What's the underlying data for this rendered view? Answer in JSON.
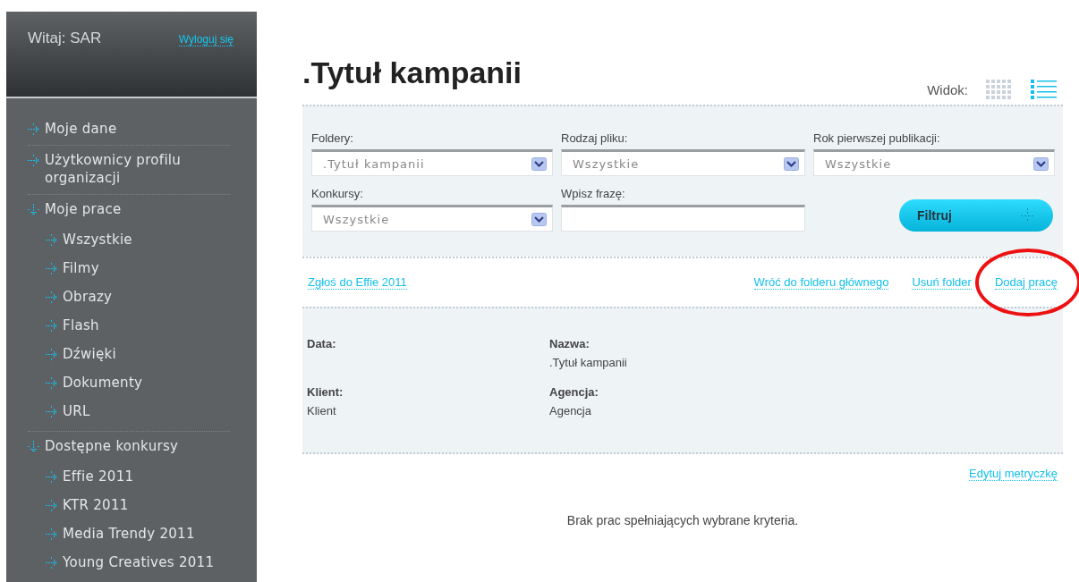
{
  "sidebar": {
    "greeting": "Witaj: SAR",
    "logout": "Wyloguj się",
    "items": [
      {
        "label": "Moje dane",
        "expanded": false
      },
      {
        "label": "Użytkownicy profilu organizacji",
        "expanded": false
      },
      {
        "label": "Moje prace",
        "expanded": true,
        "children": [
          {
            "label": "Wszystkie"
          },
          {
            "label": "Filmy"
          },
          {
            "label": "Obrazy"
          },
          {
            "label": "Flash"
          },
          {
            "label": "Dźwięki"
          },
          {
            "label": "Dokumenty"
          },
          {
            "label": "URL"
          }
        ]
      },
      {
        "label": "Dostępne konkursy",
        "expanded": true,
        "children": [
          {
            "label": "Effie 2011"
          },
          {
            "label": "KTR 2011"
          },
          {
            "label": "Media Trendy 2011"
          },
          {
            "label": "Young Creatives 2011"
          }
        ]
      }
    ]
  },
  "title": ".Tytuł kampanii",
  "view": {
    "label": "Widok:",
    "options": [
      {
        "kind": "grid",
        "selected": false
      },
      {
        "kind": "list",
        "selected": true
      }
    ]
  },
  "filters": [
    {
      "kind": "select",
      "label": "Foldery:",
      "value": ".Tytuł kampanii"
    },
    {
      "kind": "select",
      "label": "Rodzaj pliku:",
      "value": "Wszystkie"
    },
    {
      "kind": "select",
      "label": "Rok pierwszej publikacji:",
      "value": "Wszystkie"
    },
    {
      "kind": "select",
      "label": "Konkursy:",
      "value": "Wszystkie"
    },
    {
      "kind": "text",
      "label": "Wpisz frazę:"
    }
  ],
  "filter_button": "Filtruj",
  "left_link": "Zgłoś do Effie 2011",
  "actions": [
    {
      "label": "Wróć do folderu głównego",
      "highlighted": false
    },
    {
      "label": "Usuń folder",
      "highlighted": false
    },
    {
      "label": "Dodaj pracę",
      "highlighted": true
    }
  ],
  "details": [
    {
      "label": "Data:"
    },
    {
      "label": "Nazwa:",
      "value": ".Tytuł kampanii"
    },
    {
      "label": "Klient:",
      "value": "Klient"
    },
    {
      "label": "Agencja:",
      "value": "Agencja"
    }
  ],
  "edit_link": "Edytuj metryczkę",
  "message": "Brak prac spełniających wybrane kryteria."
}
